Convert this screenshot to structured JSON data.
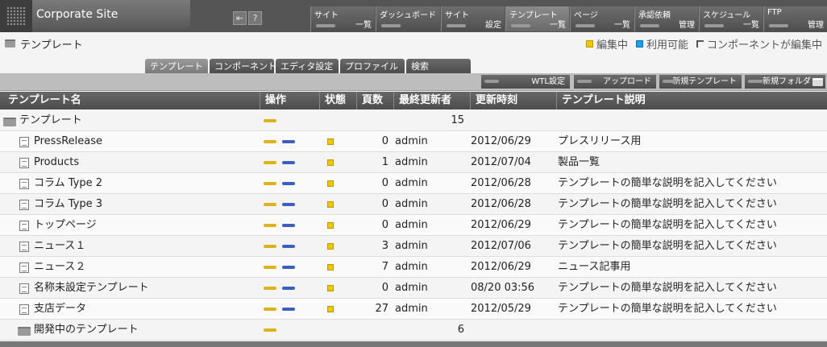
{
  "header": {
    "site_title": "Corporate Site",
    "nav": [
      {
        "top": "サイト",
        "bottom": "一覧"
      },
      {
        "top": "ダッシュボード",
        "bottom": ""
      },
      {
        "top": "サイト",
        "bottom": "設定"
      },
      {
        "top": "テンプレート",
        "bottom": "一覧"
      },
      {
        "top": "ページ",
        "bottom": "一覧"
      },
      {
        "top": "承認依頼",
        "bottom": "管理"
      },
      {
        "top": "スケジュール",
        "bottom": "一覧"
      },
      {
        "top": "FTP",
        "bottom": "管理"
      }
    ],
    "help_label": "?"
  },
  "breadcrumb": {
    "label": "テンプレート"
  },
  "legend": {
    "editing": "編集中",
    "available": "利用可能",
    "component_editing": "コンポーネントが編集中",
    "editing_color": "#f0c800",
    "available_color": "#1ea0e6"
  },
  "tabs": [
    "テンプレート",
    "コンポーネント",
    "エディタ設定",
    "プロファイル",
    "検索"
  ],
  "toolbar": {
    "wtl": "WTL設定",
    "upload": "アップロード",
    "new_template": "新規テンプレート",
    "new_folder": "新規フォルダ"
  },
  "columns": {
    "name": "テンプレート名",
    "ops": "操作",
    "status": "状態",
    "pages": "頁数",
    "updater": "最終更新者",
    "updated": "更新時刻",
    "desc": "テンプレート説明"
  },
  "root_folder": {
    "name": "テンプレート",
    "count": "15"
  },
  "rows": [
    {
      "name": "PressRelease",
      "pages": "0",
      "updater": "admin",
      "updated": "2012/06/29",
      "desc": "プレスリリース用"
    },
    {
      "name": "Products",
      "pages": "1",
      "updater": "admin",
      "updated": "2012/07/04",
      "desc": "製品一覧"
    },
    {
      "name": "コラム Type 2",
      "pages": "0",
      "updater": "admin",
      "updated": "2012/06/28",
      "desc": "テンプレートの簡単な説明を記入してください"
    },
    {
      "name": "コラム Type 3",
      "pages": "0",
      "updater": "admin",
      "updated": "2012/06/28",
      "desc": "テンプレートの簡単な説明を記入してください"
    },
    {
      "name": "トップページ",
      "pages": "0",
      "updater": "admin",
      "updated": "2012/06/29",
      "desc": "テンプレートの簡単な説明を記入してください"
    },
    {
      "name": "ニュース１",
      "pages": "3",
      "updater": "admin",
      "updated": "2012/07/06",
      "desc": "テンプレートの簡単な説明を記入してください"
    },
    {
      "name": "ニュース２",
      "pages": "7",
      "updater": "admin",
      "updated": "2012/06/29",
      "desc": "ニュース記事用"
    },
    {
      "name": "名称未設定テンプレート",
      "pages": "0",
      "updater": "admin",
      "updated": "08/20 03:56",
      "desc": "テンプレートの簡単な説明を記入してください"
    },
    {
      "name": "支店データ",
      "pages": "27",
      "updater": "admin",
      "updated": "2012/05/29",
      "desc": "テンプレートの簡単な説明を記入してください"
    }
  ],
  "dev_folder": {
    "name": "開発中のテンプレート",
    "count": "6"
  }
}
